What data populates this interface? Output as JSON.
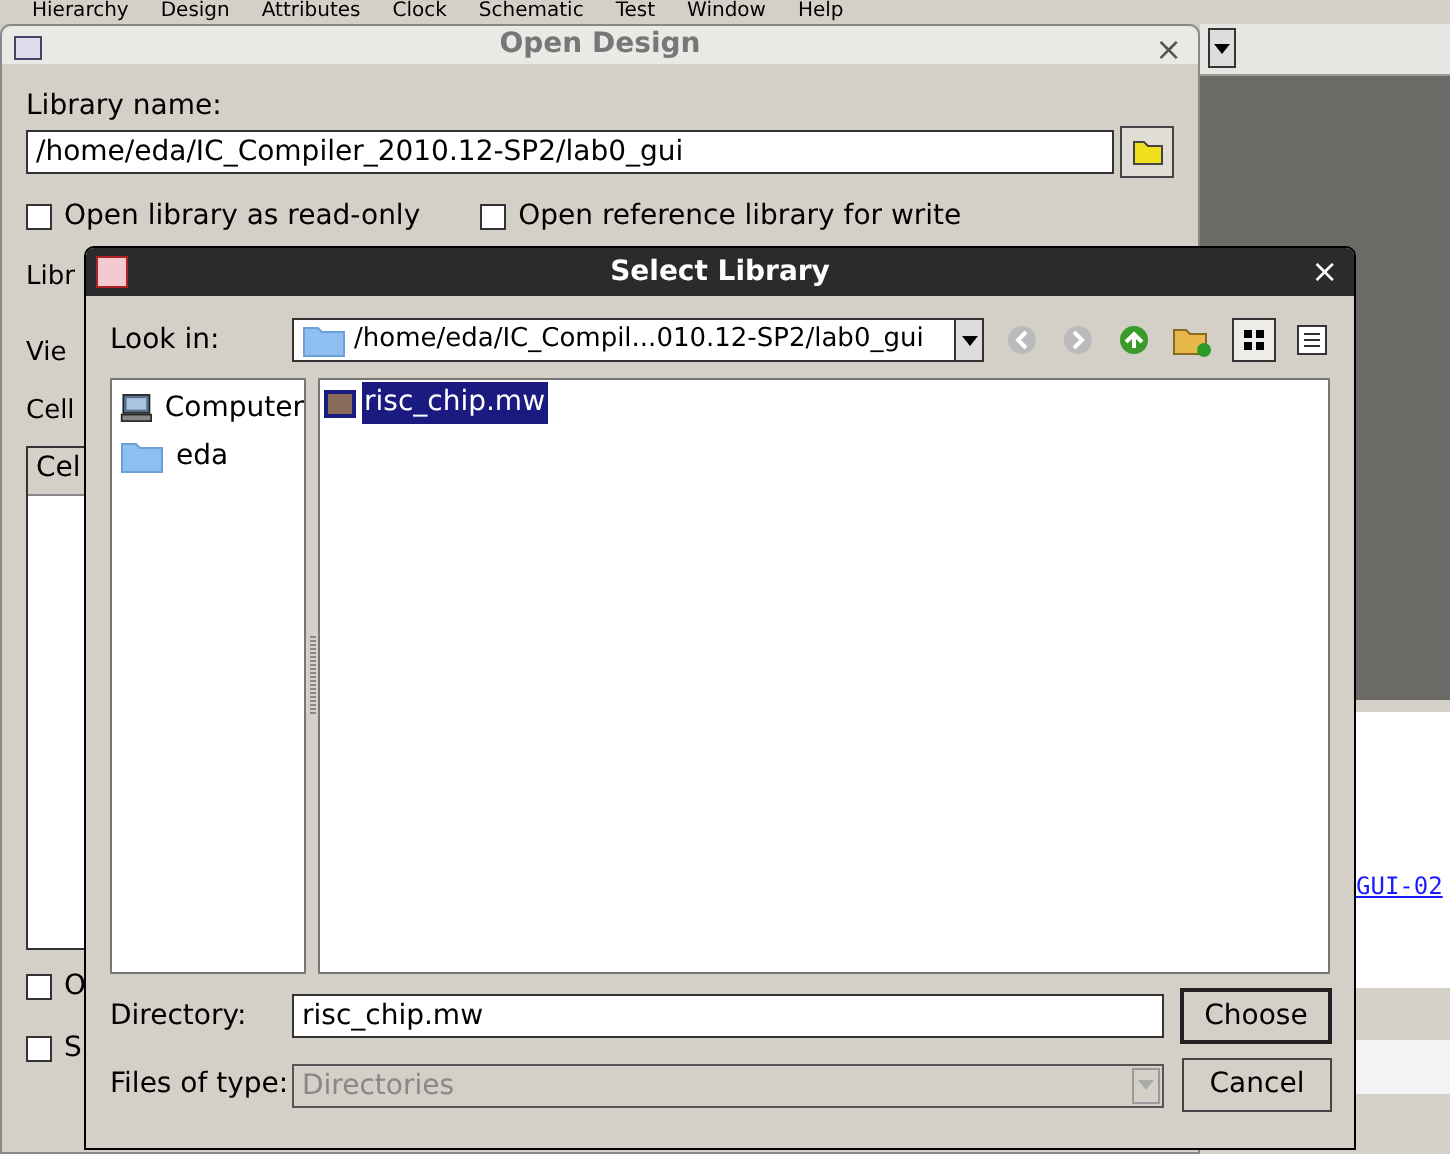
{
  "menu_bar": [
    "Hierarchy",
    "Design",
    "Attributes",
    "Clock",
    "Schematic",
    "Test",
    "Window",
    "Help"
  ],
  "background_link": "GUI-02",
  "open_design": {
    "title": "Open Design",
    "close": "×",
    "library_label": "Library name:",
    "library_value": "/home/eda/IC_Compiler_2010.12-SP2/lab0_gui",
    "checkboxes": [
      {
        "label": "Open library as read-only",
        "checked": false
      },
      {
        "label": "Open reference library for write",
        "checked": false
      }
    ],
    "partial_labels": [
      "Libr",
      "Vie",
      "Cell"
    ],
    "table_header": "Cel",
    "bottom_checkboxes": [
      {
        "label": "O",
        "checked": false
      },
      {
        "label": "S",
        "checked": false
      }
    ]
  },
  "select_library": {
    "title": "Select Library",
    "close": "×",
    "look_in_label": "Look in:",
    "look_in_value": "/home/eda/IC_Compil...010.12-SP2/lab0_gui",
    "places": [
      {
        "label": "Computer",
        "kind": "computer"
      },
      {
        "label": "eda",
        "kind": "folder"
      }
    ],
    "files": [
      {
        "name": "risc_chip.mw",
        "selected": true
      }
    ],
    "directory_label": "Directory:",
    "directory_value": "risc_chip.mw",
    "type_label": "Files of type:",
    "type_value": "Directories",
    "buttons": [
      "Choose",
      "Cancel"
    ]
  }
}
